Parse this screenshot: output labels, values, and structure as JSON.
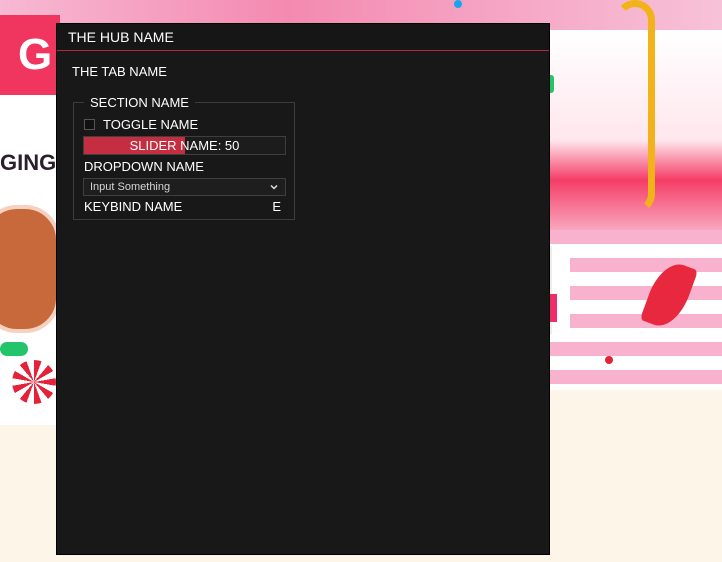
{
  "hub": {
    "title": "THE HUB NAME",
    "tab_name": "THE TAB NAME",
    "accent_color": "#c52d40",
    "section": {
      "title": "SECTION NAME",
      "toggle": {
        "label": "TOGGLE NAME",
        "checked": false
      },
      "slider": {
        "label": "SLIDER NAME: 50",
        "value": 50,
        "fill_fraction": 0.5
      },
      "dropdown": {
        "label": "DROPDOWN NAME",
        "value": "Input Something",
        "icon": "chevron-down-icon"
      },
      "keybind": {
        "label": "KEYBIND NAME",
        "key": "E"
      }
    }
  },
  "background": {
    "left_banner_letter": "G",
    "left_card_text": "GINGI"
  }
}
